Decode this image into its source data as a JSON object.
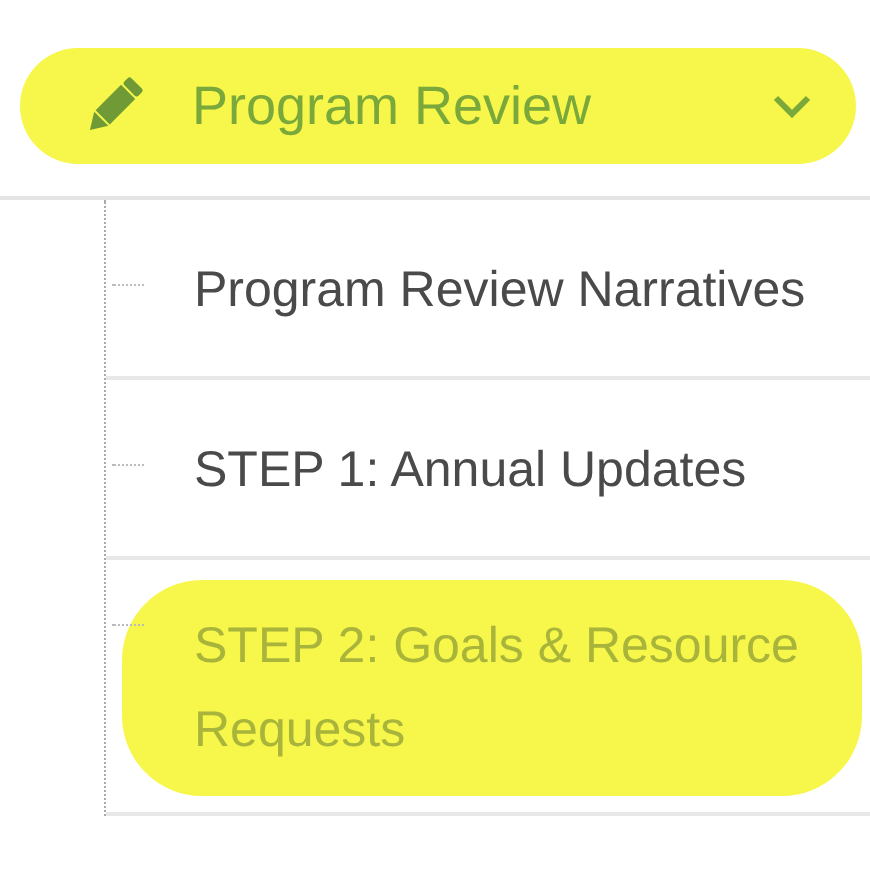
{
  "menu": {
    "title": "Program Review",
    "expanded": true,
    "highlighted": true,
    "items": [
      {
        "label": "Program Review Narratives",
        "selected": false
      },
      {
        "label": "STEP 1: Annual Updates",
        "selected": false
      },
      {
        "label": "STEP 2: Goals & Resource Requests",
        "selected": true
      }
    ]
  }
}
